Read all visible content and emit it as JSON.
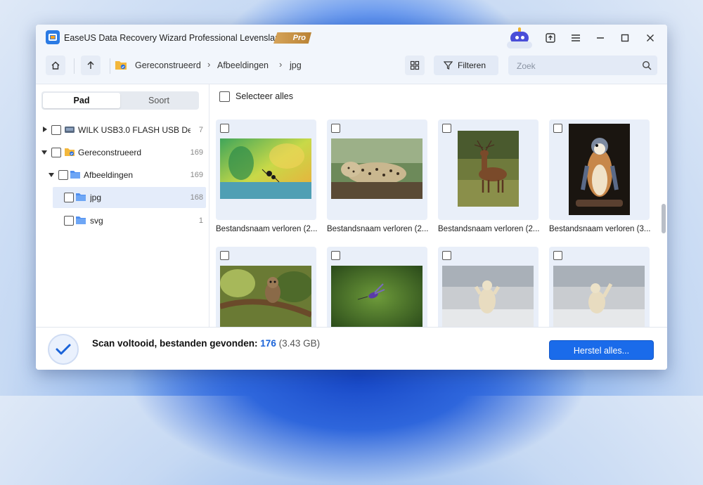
{
  "window": {
    "title": "EaseUS Data Recovery Wizard Professional Levenslang",
    "pro_badge": "Pro"
  },
  "toolbar": {
    "breadcrumbs": [
      "Gereconstrueerd",
      "Afbeeldingen",
      "jpg"
    ],
    "filter_label": "Filteren",
    "search_placeholder": "Zoek"
  },
  "sidebar": {
    "tabs": [
      {
        "label": "Pad",
        "active": true
      },
      {
        "label": "Soort",
        "active": false
      }
    ],
    "tree": [
      {
        "label": "WILK USB3.0 FLASH USB Devi...",
        "count": "7"
      },
      {
        "label": "Gereconstrueerd",
        "count": "169"
      },
      {
        "label": "Afbeeldingen",
        "count": "169"
      },
      {
        "label": "jpg",
        "count": "168"
      },
      {
        "label": "svg",
        "count": "1"
      }
    ]
  },
  "main": {
    "select_all_label": "Selecteer alles",
    "files": [
      {
        "name": "Bestandsnaam verloren (2..."
      },
      {
        "name": "Bestandsnaam verloren (2..."
      },
      {
        "name": "Bestandsnaam verloren (2..."
      },
      {
        "name": "Bestandsnaam verloren (3..."
      }
    ]
  },
  "status": {
    "text": "Scan voltooid, bestanden gevonden:",
    "count": "176",
    "size": "(3.43 GB)"
  },
  "actions": {
    "recover_all_label": "Herstel alles..."
  },
  "colors": {
    "accent": "#1a6bea",
    "count_blue": "#1a63d8"
  }
}
